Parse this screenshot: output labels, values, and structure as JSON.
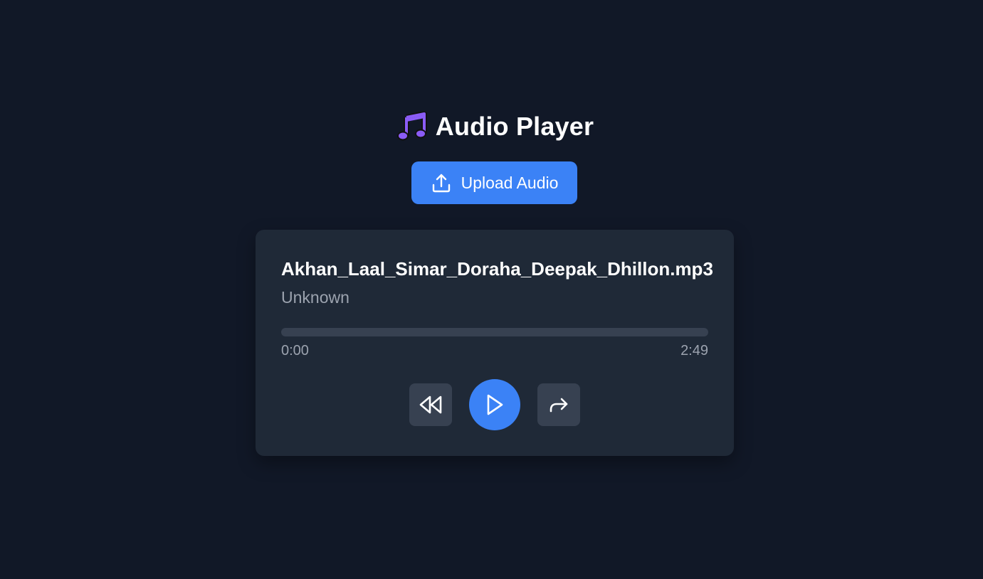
{
  "header": {
    "title": "Audio Player",
    "icon": "music-note-icon"
  },
  "upload": {
    "label": "Upload Audio",
    "icon": "upload-icon"
  },
  "player": {
    "track_title": "Akhan_Laal_Simar_Doraha_Deepak_Dhillon.mp3",
    "artist": "Unknown",
    "current_time": "0:00",
    "total_time": "2:49",
    "progress": 0,
    "controls": {
      "rewind_icon": "rewind-icon",
      "play_icon": "play-icon",
      "forward_icon": "forward-icon"
    }
  },
  "colors": {
    "background": "#111827",
    "card": "#1f2937",
    "accent": "#3b82f6",
    "control_bg": "#374151",
    "muted_text": "#9ca3af"
  }
}
